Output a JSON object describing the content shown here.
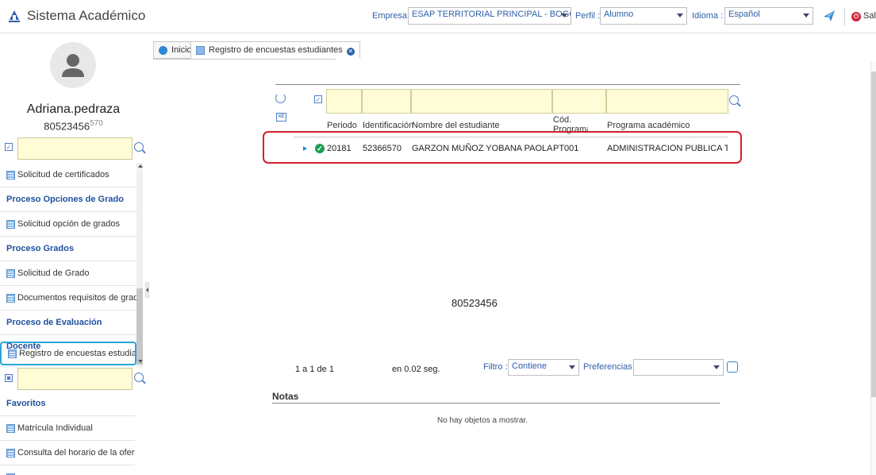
{
  "app": {
    "title": "Sistema Académico"
  },
  "topbar": {
    "empresa_label": "Empresa :",
    "empresa_value": "ESAP TERRITORIAL PRINCIPAL - BOGOTA",
    "perfil_label": "Perfil :",
    "perfil_value": "Alumno",
    "idioma_label": "Idioma :",
    "idioma_value": "Español",
    "logout_label": "Sal"
  },
  "user": {
    "name": "Adriana.pedraza",
    "id": "80523456",
    "id_suffix": "570"
  },
  "sidebar": {
    "items": [
      {
        "type": "item",
        "label": "Solicitud de certificados"
      },
      {
        "type": "header",
        "label": "Proceso Opciones de Grado"
      },
      {
        "type": "item",
        "label": "Solicitud opción de grados"
      },
      {
        "type": "header",
        "label": "Proceso Grados"
      },
      {
        "type": "item",
        "label": "Solicitud de Grado"
      },
      {
        "type": "item",
        "label": "Documentos requisitos de grado"
      },
      {
        "type": "header",
        "label": "Proceso de Evaluación Docente"
      },
      {
        "type": "item",
        "label": "Registro de encuestas estudiantes"
      }
    ],
    "favorites_header": "Favoritos",
    "favorites": [
      {
        "label": "Matrícula Individual"
      },
      {
        "label": "Consulta del horario de la oferta"
      }
    ]
  },
  "tabs": [
    {
      "label": "Inicio"
    },
    {
      "label": "Registro de encuestas estudiantes"
    }
  ],
  "grid": {
    "columns": [
      "Periodo",
      "Identificación",
      "Nombre del estudiante",
      "Cód. Programa",
      "Programa académico"
    ],
    "rows": [
      [
        "20181",
        "52366570",
        "GARZON MUÑOZ YOBANA PAOLA",
        "PT001",
        "ADMINISTRACIÓN PÚBLICA TERRITC"
      ]
    ]
  },
  "watermark_text": "80523456",
  "pager": {
    "range": "1 a 1 de 1",
    "time": "en 0.02 seg.",
    "filter_label": "Filtro :",
    "filter_value": "Contiene",
    "prefs_label": "Preferencias :",
    "prefs_value": ""
  },
  "notes": {
    "title": "Notas",
    "empty": "No hay objetos a mostrar."
  },
  "colors": {
    "accent": "#2d5fa8",
    "highlight": "#d41f2b",
    "filter_bg": "#fffcd6"
  },
  "icons": [
    "refresh-icon",
    "export-icon",
    "search-icon",
    "check-icon",
    "avatar-icon",
    "logout-icon",
    "bird-icon"
  ]
}
